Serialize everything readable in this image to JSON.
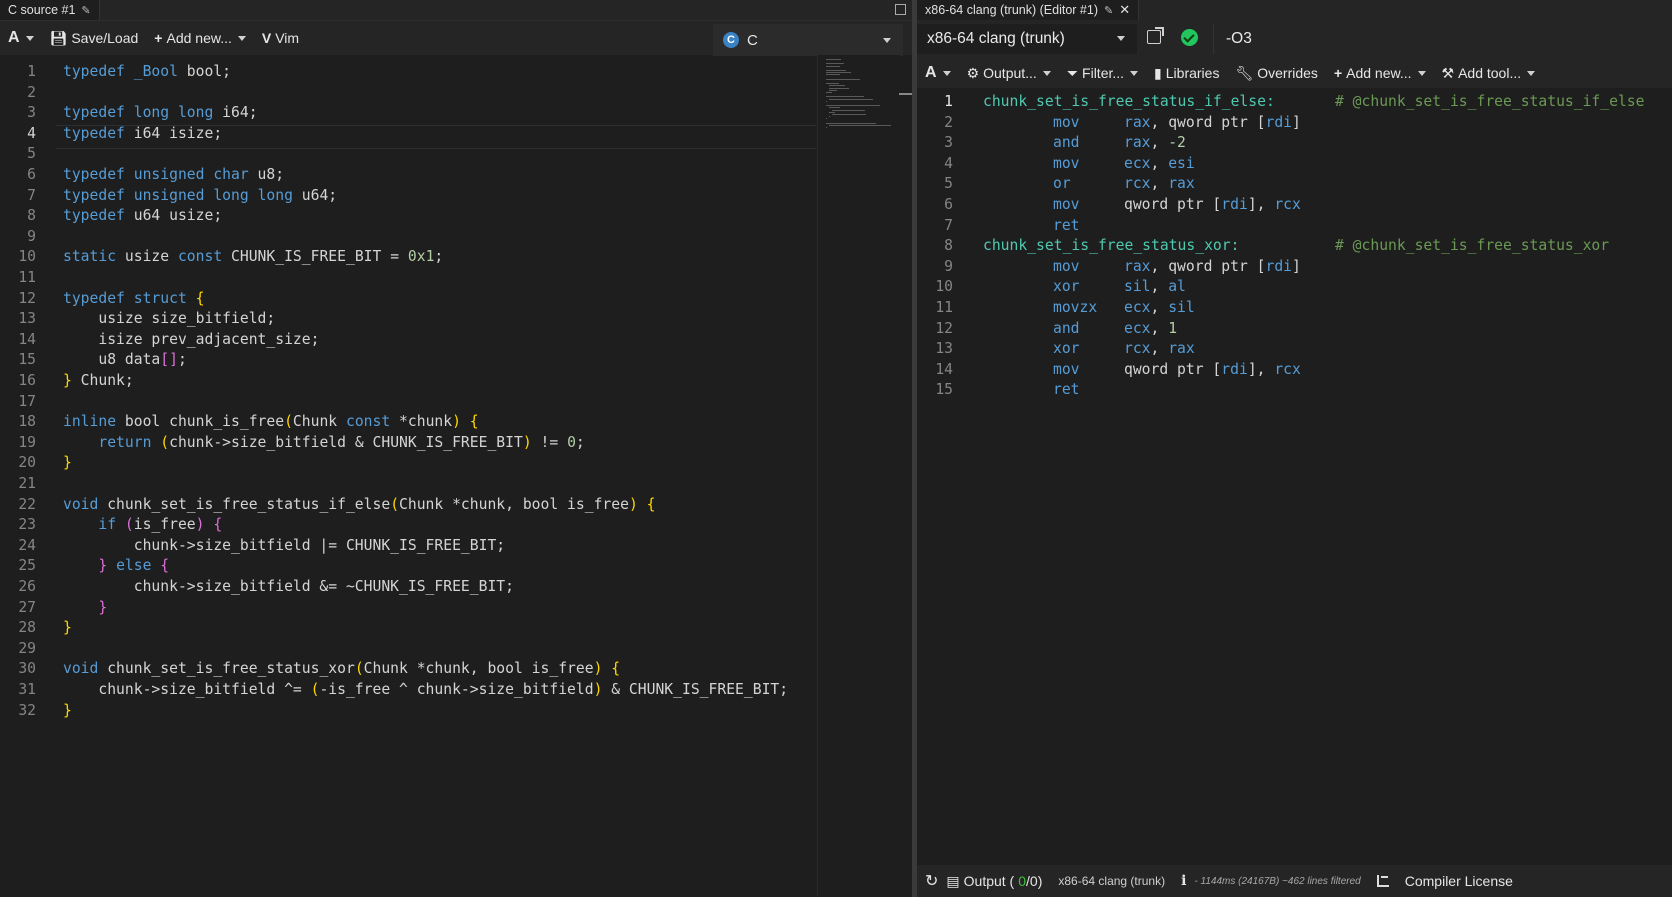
{
  "left_pane": {
    "tab_title": "C source #1",
    "toolbar": {
      "font_button": "A",
      "save_load": "Save/Load",
      "add_new": "Add new...",
      "vim": "Vim"
    },
    "language": "C",
    "source_lines": [
      "typedef _Bool bool;",
      "",
      "typedef long long i64;",
      "typedef i64 isize;",
      "",
      "typedef unsigned char u8;",
      "typedef unsigned long long u64;",
      "typedef u64 usize;",
      "",
      "static usize const CHUNK_IS_FREE_BIT = 0x1;",
      "",
      "typedef struct {",
      "    usize size_bitfield;",
      "    isize prev_adjacent_size;",
      "    u8 data[];",
      "} Chunk;",
      "",
      "inline bool chunk_is_free(Chunk const *chunk) {",
      "    return (chunk->size_bitfield & CHUNK_IS_FREE_BIT) != 0;",
      "}",
      "",
      "void chunk_set_is_free_status_if_else(Chunk *chunk, bool is_free) {",
      "    if (is_free) {",
      "        chunk->size_bitfield |= CHUNK_IS_FREE_BIT;",
      "    } else {",
      "        chunk->size_bitfield &= ~CHUNK_IS_FREE_BIT;",
      "    }",
      "}",
      "",
      "void chunk_set_is_free_status_xor(Chunk *chunk, bool is_free) {",
      "    chunk->size_bitfield ^= (-is_free ^ chunk->size_bitfield) & CHUNK_IS_FREE_BIT;",
      "}"
    ],
    "current_line": 4
  },
  "right_pane": {
    "tab_title": "x86-64 clang (trunk) (Editor #1)",
    "compiler": "x86-64 clang (trunk)",
    "flags": "-O3",
    "toolbar": {
      "font_button": "A",
      "output": "Output...",
      "filter": "Filter...",
      "libraries": "Libraries",
      "overrides": "Overrides",
      "add_new": "Add new...",
      "add_tool": "Add tool..."
    },
    "asm_lines": [
      {
        "label": "chunk_set_is_free_status_if_else:",
        "comment": "# @chunk_set_is_free_status_if_else"
      },
      {
        "op": "mov",
        "args": "rax, qword ptr [rdi]"
      },
      {
        "op": "and",
        "args": "rax, -2"
      },
      {
        "op": "mov",
        "args": "ecx, esi"
      },
      {
        "op": "or",
        "args": "rcx, rax"
      },
      {
        "op": "mov",
        "args": "qword ptr [rdi], rcx"
      },
      {
        "op": "ret",
        "args": ""
      },
      {
        "label": "chunk_set_is_free_status_xor:",
        "comment": "# @chunk_set_is_free_status_xor"
      },
      {
        "op": "mov",
        "args": "rax, qword ptr [rdi]"
      },
      {
        "op": "xor",
        "args": "sil, al"
      },
      {
        "op": "movzx",
        "args": "ecx, sil"
      },
      {
        "op": "and",
        "args": "ecx, 1"
      },
      {
        "op": "xor",
        "args": "rcx, rax"
      },
      {
        "op": "mov",
        "args": "qword ptr [rdi], rcx"
      },
      {
        "op": "ret",
        "args": ""
      }
    ],
    "bottom": {
      "output_label": "Output (",
      "output_zero": "0",
      "output_rest": "/0)",
      "compiler_name": "x86-64 clang (trunk)",
      "info_icon": "i",
      "timing": "- 1144ms (24167B) ~462 lines filtered",
      "license": "Compiler License"
    }
  },
  "colors": {
    "keyword": "#569cd6",
    "number": "#b5cea8",
    "bracket_gold": "#ffd700",
    "bracket_purple": "#da70d6",
    "label": "#4ec9b0",
    "comment": "#6a9955",
    "status_ok": "#22c55e"
  }
}
